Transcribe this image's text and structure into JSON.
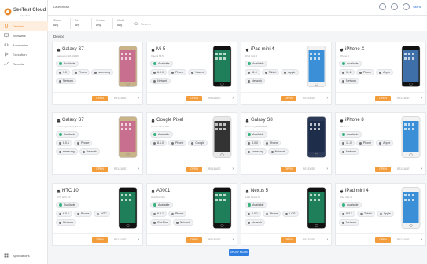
{
  "app": {
    "name": "SeeTest Cloud",
    "subtitle": "Experitest"
  },
  "nav": {
    "items": [
      {
        "label": "Devices",
        "icon": "phone-icon",
        "active": true
      },
      {
        "label": "Browsers",
        "icon": "monitor-icon"
      },
      {
        "label": "Automation",
        "icon": "code-icon"
      },
      {
        "label": "Execution",
        "icon": "play-icon"
      },
      {
        "label": "Reports",
        "icon": "chart-icon"
      }
    ],
    "bottom": {
      "label": "Applications",
      "icon": "grid-icon"
    }
  },
  "header": {
    "breadcrumb": "Launchpad",
    "user": "Yaara"
  },
  "filters": {
    "status": {
      "label": "Status",
      "value": "Any"
    },
    "os": {
      "label": "Os",
      "value": "Any"
    },
    "version": {
      "label": "Version",
      "value": "Any"
    },
    "model": {
      "label": "Model",
      "value": "Any"
    },
    "search_placeholder": "Search"
  },
  "section": {
    "title": "Device"
  },
  "card_labels": {
    "open": "OPEN",
    "release": "RELEASE"
  },
  "devices": [
    {
      "name": "Galaxy S7",
      "os": "android",
      "subtitle": "Samsung SM-G930F",
      "status": "Available",
      "tags": [
        "7.0",
        "Phone",
        "samsung",
        "Network"
      ],
      "phone": "gold"
    },
    {
      "name": "Mi 5",
      "os": "android",
      "subtitle": "Xiaomi MI 5",
      "status": "Available",
      "tags": [
        "6.0.1",
        "Phone",
        "Xiaomi",
        "Network"
      ],
      "phone": "black"
    },
    {
      "name": "iPad mini 4",
      "os": "ios",
      "subtitle": "iPad mini 4",
      "status": "Available",
      "tags": [
        "11.0",
        "Tablet",
        "Apple",
        "Network"
      ],
      "phone": "ios-white"
    },
    {
      "name": "iPhone X",
      "os": "ios",
      "subtitle": "iPhone X",
      "status": "Available",
      "tags": [
        "11.1",
        "Phone",
        "Apple",
        "Network"
      ],
      "phone": "ios-black"
    },
    {
      "name": "Galaxy S7",
      "os": "android",
      "subtitle": "Samsung Galaxy S7 Ed",
      "status": "Available",
      "tags": [
        "6.0.1",
        "Phone",
        "samsung",
        "Network"
      ],
      "phone": "gold"
    },
    {
      "name": "Google Pixel",
      "os": "android",
      "subtitle": "Google Pixel 2 XL",
      "status": "Available",
      "tags": [
        "8.1.0",
        "Phone",
        "Google"
      ],
      "phone": "white"
    },
    {
      "name": "Galaxy S8",
      "os": "android",
      "subtitle": "Samsung SM-G950F",
      "status": "Available",
      "tags": [
        "8.0.0",
        "Phone",
        "samsung",
        "Network"
      ],
      "phone": "navy"
    },
    {
      "name": "iPhone 8",
      "os": "ios",
      "subtitle": "iPhone 8",
      "status": "Available",
      "tags": [
        "11.0",
        "Phone",
        "Apple",
        "Network"
      ],
      "phone": "ios-white-small"
    },
    {
      "name": "HTC 10",
      "os": "android",
      "subtitle": "HTC HTC 10",
      "status": "Available",
      "tags": [
        "6.0.1",
        "Phone",
        "HTC",
        "Network"
      ],
      "phone": "black"
    },
    {
      "name": "A0001",
      "os": "android",
      "subtitle": "OnePlus One",
      "status": "Available",
      "tags": [
        "6.0.1",
        "Phone",
        "OnePlus",
        "Network"
      ],
      "phone": "black"
    },
    {
      "name": "Nexus 5",
      "os": "android",
      "subtitle": "LGE Nexus 5",
      "status": "Available",
      "tags": [
        "6.0.1",
        "Phone",
        "LGE",
        "Network"
      ],
      "phone": "black"
    },
    {
      "name": "iPad mini 4",
      "os": "ios",
      "subtitle": "iPad mini 4",
      "status": "Available",
      "tags": [
        "9.3.1",
        "Tablet",
        "Apple",
        "Network"
      ],
      "phone": "ios-white-small"
    }
  ],
  "show_more": "SHOW MORE",
  "colors": {
    "accent": "#f39c3b",
    "primary": "#2f7de1",
    "available": "#36b37e"
  }
}
